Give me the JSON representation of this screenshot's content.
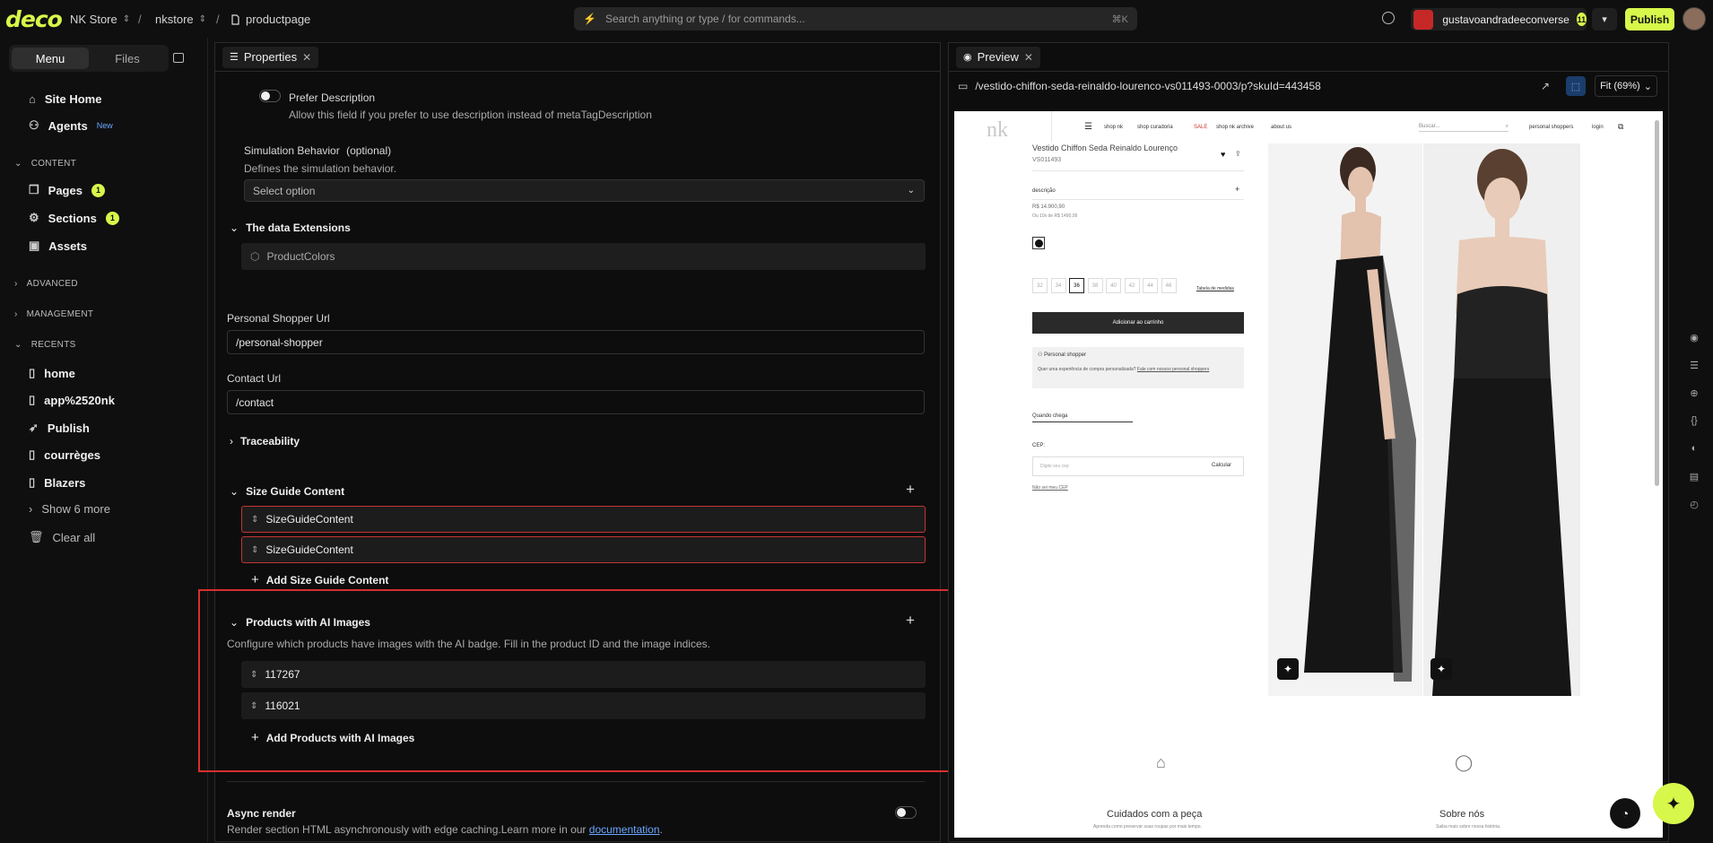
{
  "topbar": {
    "logo": "deco",
    "breadcrumbs": [
      "NK Store",
      "nkstore",
      "productpage"
    ],
    "search_placeholder": "Search anything or type / for commands...",
    "search_shortcut": "⌘K",
    "username": "gustavoandradeeconverse",
    "user_badge": "11",
    "publish_label": "Publish",
    "brand_color": "#d7f74a"
  },
  "sidebar": {
    "tabs": [
      "Menu",
      "Files"
    ],
    "items_top": [
      {
        "label": "Site Home",
        "icon": "home-icon"
      },
      {
        "label": "Agents",
        "icon": "agents-icon",
        "tag": "New"
      }
    ],
    "content_heading": "CONTENT",
    "content_items": [
      {
        "label": "Pages",
        "icon": "pages-icon",
        "badge": "1"
      },
      {
        "label": "Sections",
        "icon": "sections-icon",
        "badge": "1"
      },
      {
        "label": "Assets",
        "icon": "assets-icon"
      }
    ],
    "advanced_heading": "ADVANCED",
    "management_heading": "MANAGEMENT",
    "recents_heading": "RECENTS",
    "recents": [
      "home",
      "app%2520nk",
      "Publish",
      "courrèges",
      "Blazers"
    ],
    "show_more": "Show 6 more",
    "clear_all": "Clear all"
  },
  "properties": {
    "tab_label": "Properties",
    "prefer_description": {
      "label": "Prefer Description",
      "help": "Allow this field if you prefer to use description instead of metaTagDescription"
    },
    "simulation": {
      "label": "Simulation Behavior",
      "optional": "(optional)",
      "help": "Defines the simulation behavior.",
      "select_value": "Select option"
    },
    "data_extensions": {
      "title": "The data Extensions",
      "item": "ProductColors"
    },
    "personal_shopper": {
      "label": "Personal Shopper Url",
      "value": "/personal-shopper"
    },
    "contact": {
      "label": "Contact Url",
      "value": "/contact"
    },
    "traceability": "Traceability",
    "size_guide": {
      "title": "Size Guide Content",
      "items": [
        "SizeGuideContent",
        "SizeGuideContent"
      ],
      "add_label": "Add Size Guide Content"
    },
    "ai_images": {
      "title": "Products with AI Images",
      "help": "Configure which products have images with the AI badge. Fill in the product ID and the image indices.",
      "items": [
        "117267",
        "116021"
      ],
      "add_label": "Add Products with AI Images"
    },
    "async": {
      "title": "Async render",
      "help": "Render section HTML asynchronously with edge caching.Learn more in our ",
      "link": "documentation",
      "suffix": "."
    }
  },
  "preview": {
    "tab_label": "Preview",
    "url": "/vestido-chiffon-seda-reinaldo-lourenco-vs011493-0003/p?skuId=443458",
    "fit_label": "Fit (69%)",
    "site": {
      "logo": "nk",
      "nav": [
        "shop nk",
        "shop curadoria",
        "SALE",
        "shop nk archive",
        "about us"
      ],
      "search_placeholder": "Buscar...",
      "personal_shoppers": "personal shoppers",
      "login": "login",
      "product_title": "Vestido Chiffon Seda Reinaldo Lourenço",
      "sku": "VS011493",
      "descricao": "descrição",
      "price": "R$ 14.900,90",
      "installments": "Ou 10x de R$ 1490,09",
      "sizes": [
        "32",
        "34",
        "36",
        "38",
        "40",
        "42",
        "44",
        "46"
      ],
      "selected_size": "36",
      "size_table": "Tabela de medidas",
      "add_to_cart": "Adicionar ao carrinho",
      "ps_title": "Personal shopper",
      "ps_text": "Quer uma experiência de compra personalizada?",
      "ps_link": "Fale com nossos personal shoppers",
      "quando_chega": "Quando chega",
      "cep_label": "CEP:",
      "cep_placeholder": "Digite seu cep",
      "calcular": "Calcular",
      "nao_sei": "Não sei meu CEP",
      "care_title": "Cuidados com a peça",
      "care_text": "Aprenda como preservar suas roupas por mais tempo.",
      "about_title": "Sobre nós",
      "about_text": "Saiba mais sobre nossa história."
    }
  }
}
